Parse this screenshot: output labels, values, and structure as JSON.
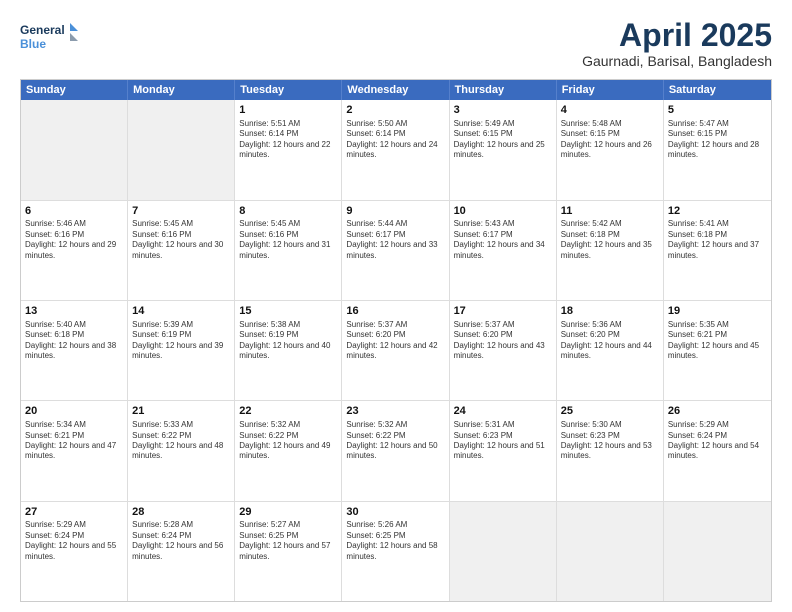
{
  "logo": {
    "line1": "General",
    "line2": "Blue"
  },
  "title": "April 2025",
  "subtitle": "Gaurnadi, Barisal, Bangladesh",
  "header_days": [
    "Sunday",
    "Monday",
    "Tuesday",
    "Wednesday",
    "Thursday",
    "Friday",
    "Saturday"
  ],
  "weeks": [
    [
      {
        "day": "",
        "text": "",
        "shaded": true
      },
      {
        "day": "",
        "text": "",
        "shaded": true
      },
      {
        "day": "1",
        "text": "Sunrise: 5:51 AM\nSunset: 6:14 PM\nDaylight: 12 hours and 22 minutes."
      },
      {
        "day": "2",
        "text": "Sunrise: 5:50 AM\nSunset: 6:14 PM\nDaylight: 12 hours and 24 minutes."
      },
      {
        "day": "3",
        "text": "Sunrise: 5:49 AM\nSunset: 6:15 PM\nDaylight: 12 hours and 25 minutes."
      },
      {
        "day": "4",
        "text": "Sunrise: 5:48 AM\nSunset: 6:15 PM\nDaylight: 12 hours and 26 minutes."
      },
      {
        "day": "5",
        "text": "Sunrise: 5:47 AM\nSunset: 6:15 PM\nDaylight: 12 hours and 28 minutes."
      }
    ],
    [
      {
        "day": "6",
        "text": "Sunrise: 5:46 AM\nSunset: 6:16 PM\nDaylight: 12 hours and 29 minutes."
      },
      {
        "day": "7",
        "text": "Sunrise: 5:45 AM\nSunset: 6:16 PM\nDaylight: 12 hours and 30 minutes."
      },
      {
        "day": "8",
        "text": "Sunrise: 5:45 AM\nSunset: 6:16 PM\nDaylight: 12 hours and 31 minutes."
      },
      {
        "day": "9",
        "text": "Sunrise: 5:44 AM\nSunset: 6:17 PM\nDaylight: 12 hours and 33 minutes."
      },
      {
        "day": "10",
        "text": "Sunrise: 5:43 AM\nSunset: 6:17 PM\nDaylight: 12 hours and 34 minutes."
      },
      {
        "day": "11",
        "text": "Sunrise: 5:42 AM\nSunset: 6:18 PM\nDaylight: 12 hours and 35 minutes."
      },
      {
        "day": "12",
        "text": "Sunrise: 5:41 AM\nSunset: 6:18 PM\nDaylight: 12 hours and 37 minutes."
      }
    ],
    [
      {
        "day": "13",
        "text": "Sunrise: 5:40 AM\nSunset: 6:18 PM\nDaylight: 12 hours and 38 minutes."
      },
      {
        "day": "14",
        "text": "Sunrise: 5:39 AM\nSunset: 6:19 PM\nDaylight: 12 hours and 39 minutes."
      },
      {
        "day": "15",
        "text": "Sunrise: 5:38 AM\nSunset: 6:19 PM\nDaylight: 12 hours and 40 minutes."
      },
      {
        "day": "16",
        "text": "Sunrise: 5:37 AM\nSunset: 6:20 PM\nDaylight: 12 hours and 42 minutes."
      },
      {
        "day": "17",
        "text": "Sunrise: 5:37 AM\nSunset: 6:20 PM\nDaylight: 12 hours and 43 minutes."
      },
      {
        "day": "18",
        "text": "Sunrise: 5:36 AM\nSunset: 6:20 PM\nDaylight: 12 hours and 44 minutes."
      },
      {
        "day": "19",
        "text": "Sunrise: 5:35 AM\nSunset: 6:21 PM\nDaylight: 12 hours and 45 minutes."
      }
    ],
    [
      {
        "day": "20",
        "text": "Sunrise: 5:34 AM\nSunset: 6:21 PM\nDaylight: 12 hours and 47 minutes."
      },
      {
        "day": "21",
        "text": "Sunrise: 5:33 AM\nSunset: 6:22 PM\nDaylight: 12 hours and 48 minutes."
      },
      {
        "day": "22",
        "text": "Sunrise: 5:32 AM\nSunset: 6:22 PM\nDaylight: 12 hours and 49 minutes."
      },
      {
        "day": "23",
        "text": "Sunrise: 5:32 AM\nSunset: 6:22 PM\nDaylight: 12 hours and 50 minutes."
      },
      {
        "day": "24",
        "text": "Sunrise: 5:31 AM\nSunset: 6:23 PM\nDaylight: 12 hours and 51 minutes."
      },
      {
        "day": "25",
        "text": "Sunrise: 5:30 AM\nSunset: 6:23 PM\nDaylight: 12 hours and 53 minutes."
      },
      {
        "day": "26",
        "text": "Sunrise: 5:29 AM\nSunset: 6:24 PM\nDaylight: 12 hours and 54 minutes."
      }
    ],
    [
      {
        "day": "27",
        "text": "Sunrise: 5:29 AM\nSunset: 6:24 PM\nDaylight: 12 hours and 55 minutes."
      },
      {
        "day": "28",
        "text": "Sunrise: 5:28 AM\nSunset: 6:24 PM\nDaylight: 12 hours and 56 minutes."
      },
      {
        "day": "29",
        "text": "Sunrise: 5:27 AM\nSunset: 6:25 PM\nDaylight: 12 hours and 57 minutes."
      },
      {
        "day": "30",
        "text": "Sunrise: 5:26 AM\nSunset: 6:25 PM\nDaylight: 12 hours and 58 minutes."
      },
      {
        "day": "",
        "text": "",
        "shaded": true
      },
      {
        "day": "",
        "text": "",
        "shaded": true
      },
      {
        "day": "",
        "text": "",
        "shaded": true
      }
    ]
  ]
}
